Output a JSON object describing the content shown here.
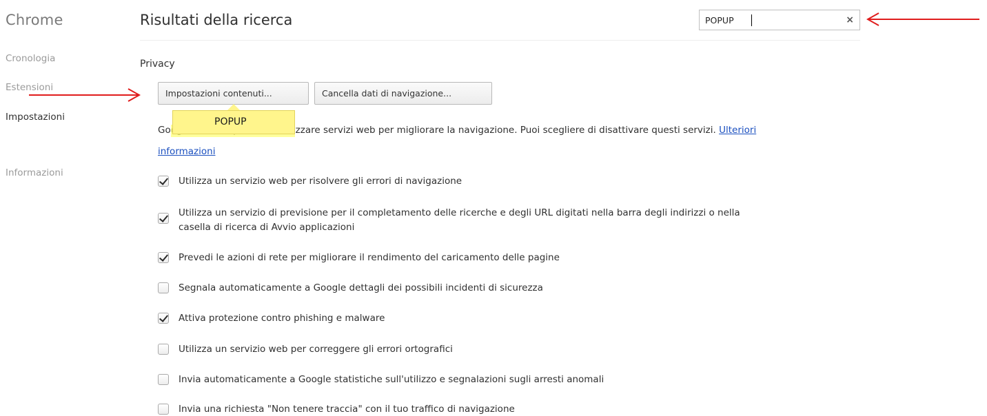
{
  "sidebar": {
    "brand": "Chrome",
    "items": [
      {
        "label": "Cronologia"
      },
      {
        "label": "Estensioni"
      },
      {
        "label": "Impostazioni"
      },
      {
        "label": "Informazioni"
      }
    ]
  },
  "header": {
    "title": "Risultati della ricerca",
    "search": {
      "value": "POPUP",
      "clear_label": "×"
    }
  },
  "privacy": {
    "section_title": "Privacy",
    "buttons": {
      "content_settings": "Impostazioni contenuti...",
      "clear_data": "Cancella dati di navigazione..."
    },
    "bubble": "POPUP",
    "description": "Google Chrome potrebbe utilizzare servizi web per migliorare la navigazione. Puoi scegliere di disattivare questi servizi.",
    "learn_more": "Ulteriori informazioni",
    "options": [
      {
        "label": "Utilizza un servizio web per risolvere gli errori di navigazione",
        "checked": true
      },
      {
        "label": "Utilizza un servizio di previsione per il completamento delle ricerche e degli URL digitati nella barra degli indirizzi o nella casella di ricerca di Avvio applicazioni",
        "checked": true
      },
      {
        "label": "Prevedi le azioni di rete per migliorare il rendimento del caricamento delle pagine",
        "checked": true
      },
      {
        "label": "Segnala automaticamente a Google dettagli dei possibili incidenti di sicurezza",
        "checked": false
      },
      {
        "label": "Attiva protezione contro phishing e malware",
        "checked": true
      },
      {
        "label": "Utilizza un servizio web per correggere gli errori ortografici",
        "checked": false
      },
      {
        "label": "Invia automaticamente a Google statistiche sull'utilizzo e segnalazioni sugli arresti anomali",
        "checked": false
      },
      {
        "label": "Invia una richiesta \"Non tenere traccia\" con il tuo traffico di navigazione",
        "checked": false
      }
    ]
  },
  "colors": {
    "annotation_arrow": "#e01c1c",
    "search_highlight": "#fff58c",
    "link": "#1a4fbf"
  }
}
